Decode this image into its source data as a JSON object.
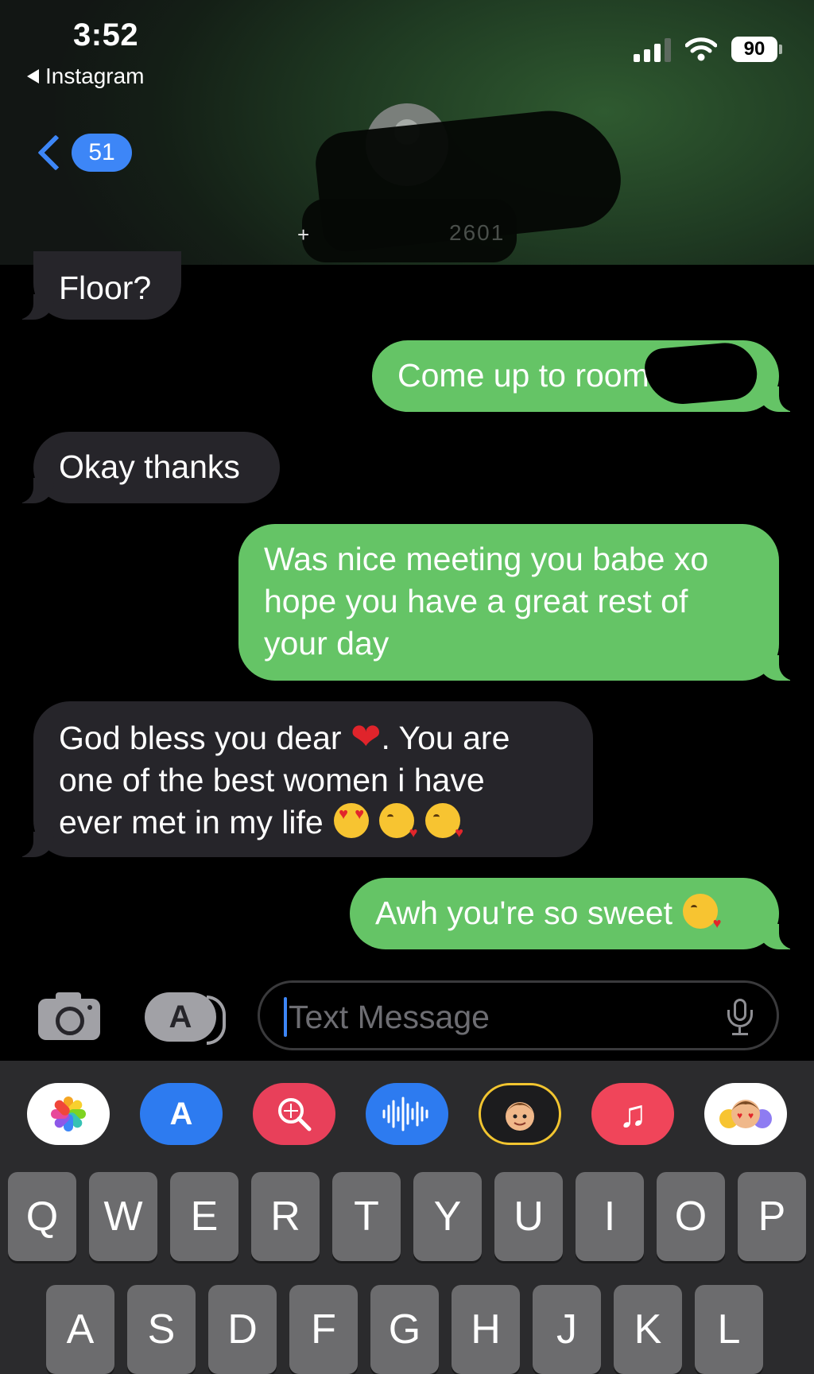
{
  "status_bar": {
    "time": "3:52",
    "back_app": "Instagram",
    "battery": "90"
  },
  "nav": {
    "unread_count": "51",
    "contact_prefix": "+",
    "contact_suffix": "2601"
  },
  "messages": [
    {
      "direction": "incoming",
      "text": "Floor?"
    },
    {
      "direction": "outgoing",
      "text": "Come up to room"
    },
    {
      "direction": "incoming",
      "text": "Okay thanks"
    },
    {
      "direction": "outgoing",
      "lines": [
        "Was nice meeting you babe xo",
        "hope you have a great rest of",
        "your day"
      ]
    },
    {
      "direction": "incoming",
      "lines": [
        "God bless you dear",
        ". You are",
        "one of the best women i have",
        "ever met in my life"
      ]
    },
    {
      "direction": "outgoing",
      "text": "Awh you're so sweet"
    }
  ],
  "input": {
    "placeholder": "Text Message"
  },
  "app_strip": [
    "photos-icon",
    "app-store-icon",
    "search-images-icon",
    "audio-message-icon",
    "memoji-icon",
    "music-icon",
    "memoji-stickers-icon"
  ],
  "keyboard": {
    "row1": [
      "Q",
      "W",
      "E",
      "R",
      "T",
      "Y",
      "U",
      "I",
      "O",
      "P"
    ],
    "row2": [
      "A",
      "S",
      "D",
      "F",
      "G",
      "H",
      "J",
      "K",
      "L"
    ]
  },
  "colors": {
    "outgoing": "#65c466",
    "incoming": "#26252a",
    "accent": "#3d86f7"
  }
}
